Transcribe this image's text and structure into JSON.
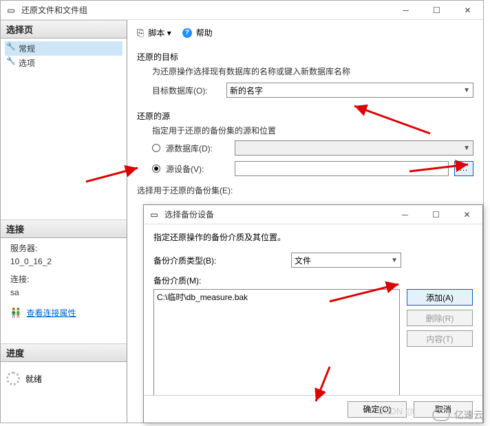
{
  "main": {
    "title": "还原文件和文件组",
    "sidebar": {
      "section_select": "选择页",
      "items": [
        "常规",
        "选项"
      ],
      "section_conn": "连接",
      "server_label": "服务器:",
      "server_value": "10_0_16_2",
      "conn_label": "连接:",
      "conn_value": "sa",
      "view_conn_props": "查看连接属性",
      "section_progress": "进度",
      "progress_status": "就绪"
    },
    "content": {
      "script_label": "脚本",
      "help_label": "帮助",
      "dest_title": "还原的目标",
      "dest_sub": "为还原操作选择现有数据库的名称或键入新数据库名称",
      "dest_db_label": "目标数据库(O):",
      "dest_db_value": "新的名字",
      "src_title": "还原的源",
      "src_sub": "指定用于还原的备份集的源和位置",
      "src_db_label": "源数据库(D):",
      "src_db_value": "",
      "src_dev_label": "源设备(V):",
      "src_dev_value": "",
      "browse_btn": "...",
      "select_sets_label": "选择用于还原的备份集(E):"
    }
  },
  "sub": {
    "title": "选择备份设备",
    "instruction": "指定还原操作的备份介质及其位置。",
    "media_type_label": "备份介质类型(B):",
    "media_type_value": "文件",
    "media_label": "备份介质(M):",
    "list_item": "C:\\临时\\db_measure.bak",
    "btn_add": "添加(A)",
    "btn_remove": "删除(R)",
    "btn_content": "内容(T)",
    "btn_ok": "确定(O)",
    "btn_cancel": "取消"
  },
  "watermark": {
    "csdn": "CSDN @",
    "brand": "亿速云"
  }
}
